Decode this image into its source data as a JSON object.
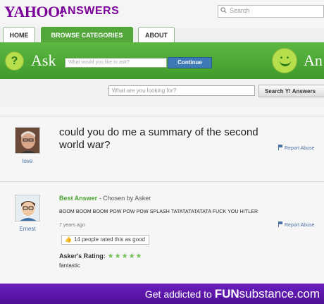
{
  "header": {
    "logo": "YAHOO!",
    "logo_sub": "ANSWERS",
    "search_placeholder": "Search"
  },
  "tabs": [
    {
      "label": "HOME"
    },
    {
      "label": "BROWSE CATEGORIES"
    },
    {
      "label": "ABOUT"
    }
  ],
  "askbar": {
    "ask_word": "Ask",
    "ask_placeholder": "What would you like to ask?",
    "continue_label": "Continue",
    "answer_word": "An"
  },
  "search": {
    "placeholder": "What are you looking for?",
    "button_label": "Search Y! Answers"
  },
  "question": {
    "user": "love",
    "text": "could you do me a summary of the second world war?",
    "report_label": "Report Abuse"
  },
  "answer": {
    "user": "Ernest",
    "best_label": "Best Answer",
    "chosen_label": " - Chosen by Asker",
    "text": "BOOM BOOM BOOM POW POW POW SPLASH TATATATATATATA  FUCK YOU HITLER",
    "ago": "7 years ago",
    "report_label": "Report Abuse",
    "rated_label": "14 people rated this as good",
    "rating_label": "Asker's Rating:",
    "stars": "★★★★★",
    "rating_value": 5,
    "comment": "fantastic"
  },
  "banner": {
    "prefix": "Get addicted to ",
    "fun": "FUN",
    "rest": "substance.com"
  },
  "colors": {
    "brand_purple": "#7b0099",
    "green": "#53a73a",
    "banner_purple": "#5a16a8",
    "link_blue": "#4a6fa5"
  }
}
